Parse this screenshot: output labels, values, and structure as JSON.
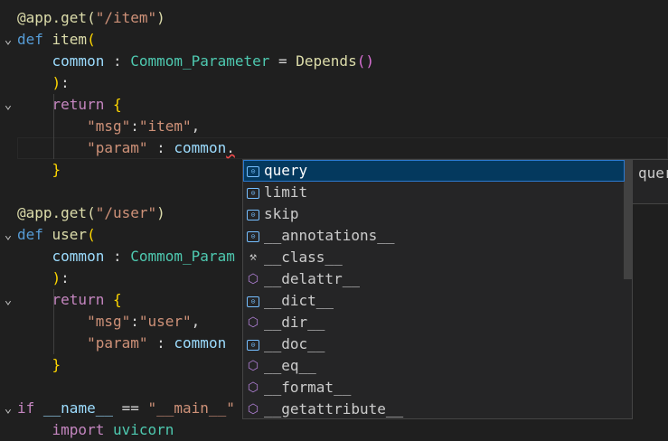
{
  "code": {
    "lines": [
      {
        "fold": "",
        "tokens": [
          {
            "t": "@app.get(",
            "c": "dec"
          },
          {
            "t": "\"/item\"",
            "c": "str"
          },
          {
            "t": ")",
            "c": "dec"
          }
        ]
      },
      {
        "fold": "⌄",
        "tokens": [
          {
            "t": "def ",
            "c": "kw"
          },
          {
            "t": "item",
            "c": "fn"
          },
          {
            "t": "(",
            "c": "bk1"
          }
        ]
      },
      {
        "fold": "",
        "tokens": [
          {
            "t": "    "
          },
          {
            "t": "common",
            "c": "var"
          },
          {
            "t": " : "
          },
          {
            "t": "Commom_Parameter",
            "c": "cls"
          },
          {
            "t": " = "
          },
          {
            "t": "Depends",
            "c": "fn"
          },
          {
            "t": "()",
            "c": "bk2"
          }
        ]
      },
      {
        "fold": "",
        "tokens": [
          {
            "t": "    "
          },
          {
            "t": ")",
            "c": "bk1"
          },
          {
            "t": ":"
          }
        ]
      },
      {
        "fold": "⌄",
        "tokens": [
          {
            "t": "    "
          },
          {
            "t": "return ",
            "c": "ctl"
          },
          {
            "t": "{",
            "c": "bk1"
          }
        ]
      },
      {
        "fold": "",
        "tokens": [
          {
            "t": "        "
          },
          {
            "t": "\"msg\"",
            "c": "str"
          },
          {
            "t": ":"
          },
          {
            "t": "\"item\"",
            "c": "str"
          },
          {
            "t": ","
          }
        ]
      },
      {
        "fold": "",
        "tokens": [
          {
            "t": "        "
          },
          {
            "t": "\"param\"",
            "c": "str"
          },
          {
            "t": " : "
          },
          {
            "t": "common",
            "c": "var"
          },
          {
            "t": ".",
            "c": "squig"
          }
        ]
      },
      {
        "fold": "",
        "tokens": [
          {
            "t": "    "
          },
          {
            "t": "}",
            "c": "bk1"
          }
        ]
      },
      {
        "fold": "",
        "tokens": []
      },
      {
        "fold": "",
        "tokens": [
          {
            "t": "@app.get(",
            "c": "dec"
          },
          {
            "t": "\"/user\"",
            "c": "str"
          },
          {
            "t": ")",
            "c": "dec"
          }
        ]
      },
      {
        "fold": "⌄",
        "tokens": [
          {
            "t": "def ",
            "c": "kw"
          },
          {
            "t": "user",
            "c": "fn"
          },
          {
            "t": "(",
            "c": "bk1"
          }
        ]
      },
      {
        "fold": "",
        "tokens": [
          {
            "t": "    "
          },
          {
            "t": "common",
            "c": "var"
          },
          {
            "t": " : "
          },
          {
            "t": "Commom_Param",
            "c": "cls"
          }
        ]
      },
      {
        "fold": "",
        "tokens": [
          {
            "t": "    "
          },
          {
            "t": ")",
            "c": "bk1"
          },
          {
            "t": ":"
          }
        ]
      },
      {
        "fold": "⌄",
        "tokens": [
          {
            "t": "    "
          },
          {
            "t": "return ",
            "c": "ctl"
          },
          {
            "t": "{",
            "c": "bk1"
          }
        ]
      },
      {
        "fold": "",
        "tokens": [
          {
            "t": "        "
          },
          {
            "t": "\"msg\"",
            "c": "str"
          },
          {
            "t": ":"
          },
          {
            "t": "\"user\"",
            "c": "str"
          },
          {
            "t": ","
          }
        ]
      },
      {
        "fold": "",
        "tokens": [
          {
            "t": "        "
          },
          {
            "t": "\"param\"",
            "c": "str"
          },
          {
            "t": " : "
          },
          {
            "t": "common",
            "c": "var"
          }
        ]
      },
      {
        "fold": "",
        "tokens": [
          {
            "t": "    "
          },
          {
            "t": "}",
            "c": "bk1"
          }
        ]
      },
      {
        "fold": "",
        "tokens": []
      },
      {
        "fold": "⌄",
        "tokens": [
          {
            "t": "if ",
            "c": "ctl"
          },
          {
            "t": "__name__",
            "c": "var"
          },
          {
            "t": " == "
          },
          {
            "t": "\"__main__\"",
            "c": "str"
          }
        ]
      },
      {
        "fold": "",
        "tokens": [
          {
            "t": "    "
          },
          {
            "t": "import ",
            "c": "ctl"
          },
          {
            "t": "uvicorn",
            "c": "cls"
          }
        ]
      }
    ]
  },
  "suggest": {
    "selected_index": 0,
    "items": [
      {
        "label": "query",
        "icon": "field-icon",
        "match": ""
      },
      {
        "label": "limit",
        "icon": "field-icon",
        "match": ""
      },
      {
        "label": "skip",
        "icon": "field-icon",
        "match": ""
      },
      {
        "label": "__annotations__",
        "icon": "field-icon",
        "match": ""
      },
      {
        "label": "__class__",
        "icon": "wrench-icon",
        "match": ""
      },
      {
        "label": "__delattr__",
        "icon": "method-icon",
        "match": ""
      },
      {
        "label": "__dict__",
        "icon": "field-icon",
        "match": ""
      },
      {
        "label": "__dir__",
        "icon": "method-icon",
        "match": ""
      },
      {
        "label": "__doc__",
        "icon": "field-icon",
        "match": ""
      },
      {
        "label": "__eq__",
        "icon": "method-icon",
        "match": ""
      },
      {
        "label": "__format__",
        "icon": "method-icon",
        "match": ""
      },
      {
        "label": "__getattribute__",
        "icon": "method-icon",
        "match": ""
      }
    ],
    "details_text": "quer"
  },
  "colors": {
    "background": "#1f1f1f",
    "suggest_bg": "#252526",
    "selected_bg": "#04395e"
  }
}
